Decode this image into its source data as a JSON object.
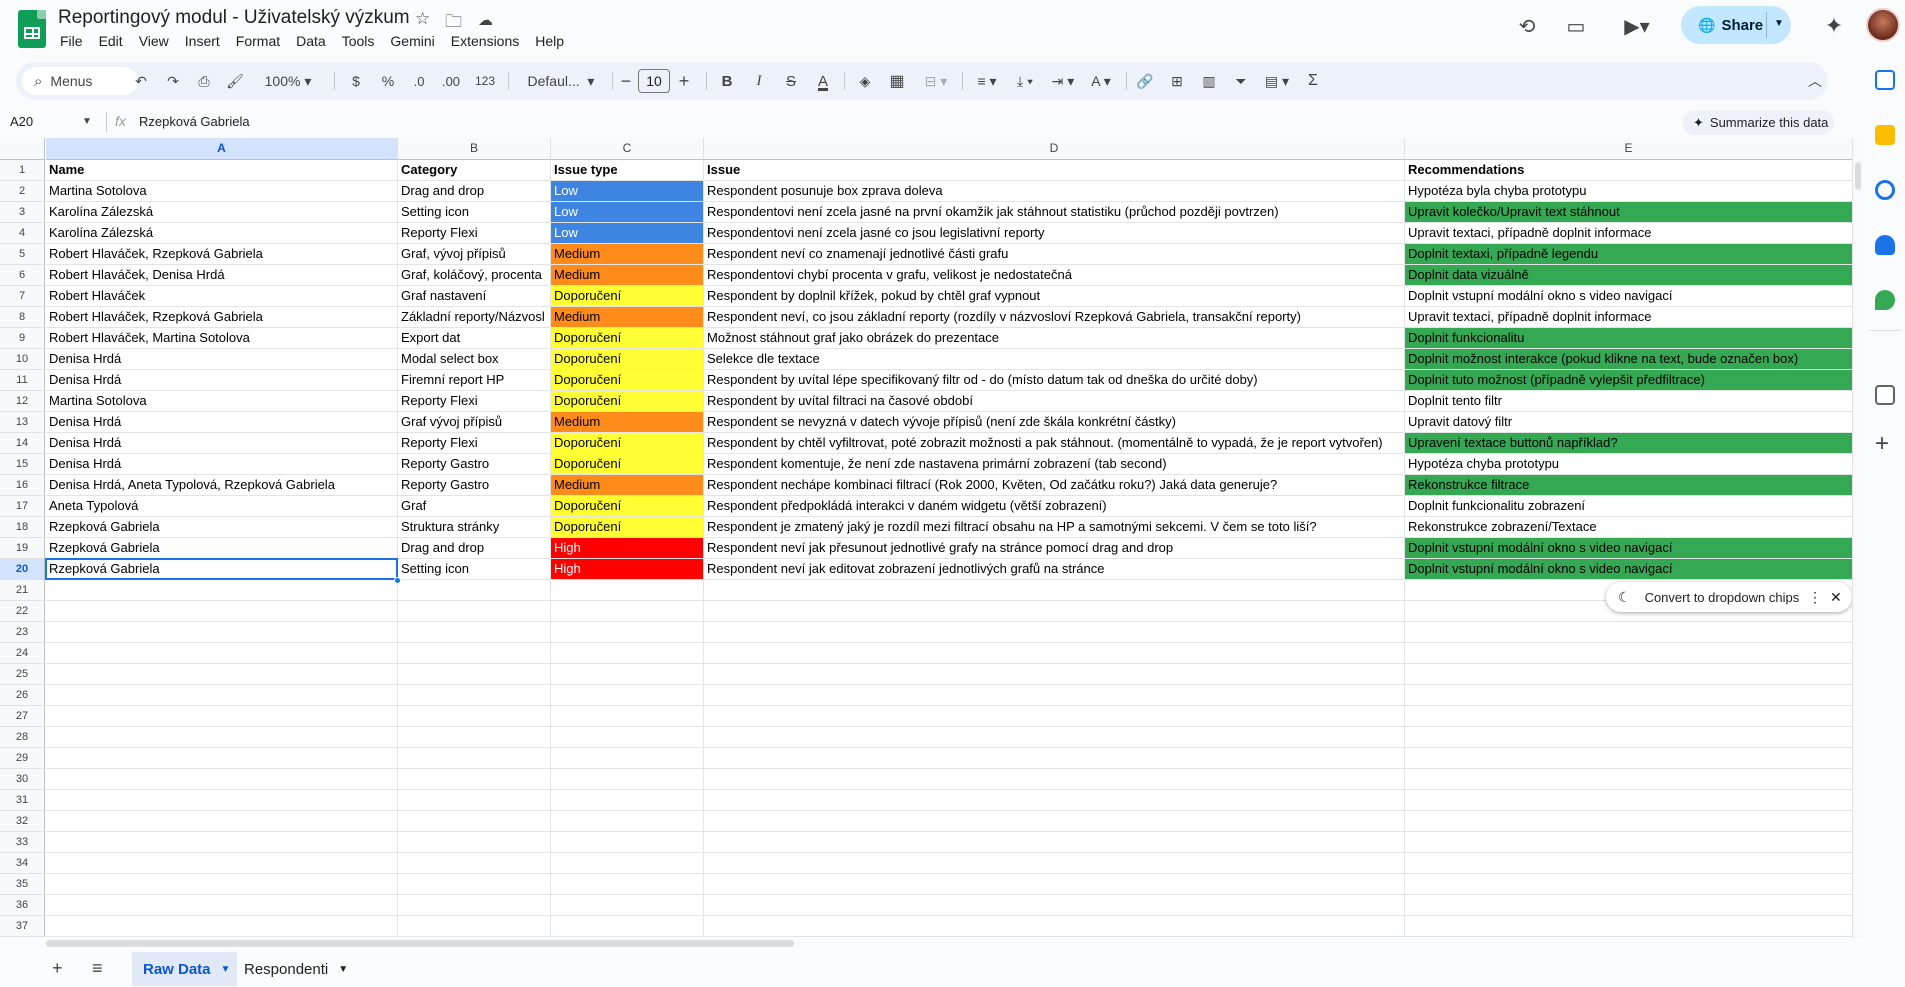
{
  "title": "Reportingový modul - Uživatelský výzkum",
  "menu": [
    "File",
    "Edit",
    "View",
    "Insert",
    "Format",
    "Data",
    "Tools",
    "Gemini",
    "Extensions",
    "Help"
  ],
  "share_label": "Share",
  "toolbar": {
    "search": "Menus",
    "zoom": "100%",
    "currency": "$",
    "percent": "%",
    "dec_decrease": ".0",
    "dec_increase": ".00",
    "number_format": "123",
    "font": "Defaul...",
    "font_size": "10"
  },
  "formula_bar": {
    "cell_ref": "A20",
    "fx": "fx",
    "value": "Rzepková Gabriela",
    "summarize": "Summarize this data"
  },
  "columns": [
    "A",
    "B",
    "C",
    "D",
    "E"
  ],
  "rows": [
    [
      "Name",
      "Category",
      "Issue type",
      "Issue",
      "Recommendations"
    ],
    [
      "Martina Sotolova",
      "Drag and drop",
      "Low",
      "Respondent posunuje box zprava doleva",
      "Hypotéza byla chyba prototypu"
    ],
    [
      "Karolína Zálezská",
      "Setting icon",
      "Low",
      "Respondentovi není zcela jasné na první okamžik jak stáhnout statistiku (průchod později povtrzen)",
      "Upravit kolečko/Upravit text stáhnout"
    ],
    [
      "Karolína Zálezská",
      "Reporty Flexi",
      "Low",
      "Respondentovi není zcela jasné co jsou legislativní reporty",
      "Upravit textaci, případně doplnit informace"
    ],
    [
      "Robert Hlaváček, Rzepková Gabriela",
      "Graf, vývoj přípisů",
      "Medium",
      "Respondent neví co znamenají jednotlivé části grafu",
      "Doplnit textaxi, případně legendu"
    ],
    [
      "Robert Hlaváček, Denisa Hrdá",
      "Graf, koláčový, procenta",
      "Medium",
      "Respondentovi chybí procenta v grafu, velikost je nedostatečná",
      "Doplnit data vizuálně"
    ],
    [
      "Robert Hlaváček",
      "Graf nastavení",
      "Doporučení",
      "Respondent by doplnil křížek, pokud by chtěl graf vypnout",
      "Doplnit vstupní modální okno s video navigací"
    ],
    [
      "Robert Hlaváček, Rzepková Gabriela",
      "Základní reporty/Názvosl",
      "Medium",
      "Respondent neví, co jsou základní reporty (rozdíly v názvosloví Rzepková Gabriela, transakční reporty)",
      "Upravit textaci, případně doplnit informace"
    ],
    [
      "Robert Hlaváček, Martina Sotolova",
      "Export dat",
      "Doporučení",
      "Možnost stáhnout graf jako obrázek do prezentace",
      "Doplnit funkcionalitu"
    ],
    [
      "Denisa Hrdá",
      "Modal select box",
      "Doporučení",
      "Selekce dle textace",
      "Doplnit možnost interakce (pokud klikne na text, bude označen box)"
    ],
    [
      "Denisa Hrdá",
      "Firemní report HP",
      "Doporučení",
      "Respondent by uvítal lépe specifikovaný filtr od - do (místo datum tak od dneška do určité doby)",
      "Doplnit tuto možnost (případně vylepšit předfiltrace)"
    ],
    [
      "Martina Sotolova",
      "Reporty Flexi",
      "Doporučení",
      "Respondent by uvítal filtraci na časové období",
      "Doplnit tento filtr"
    ],
    [
      "Denisa Hrdá",
      "Graf vývoj přípisů",
      "Medium",
      "Respondent se nevyzná v datech vývoje přípisů (není zde škála konkrétní částky)",
      "Upravit datový filtr"
    ],
    [
      "Denisa Hrdá",
      "Reporty Flexi",
      "Doporučení",
      "Respondent by chtěl vyfiltrovat, poté zobrazit možnosti a pak stáhnout. (momentálně to vypadá, že je report vytvořen)",
      "Upravení textace buttonů například?"
    ],
    [
      "Denisa Hrdá",
      "Reporty Gastro",
      "Doporučení",
      "Respondent komentuje, že není zde nastavena primární zobrazení (tab second)",
      "Hypotéza chyba prototypu"
    ],
    [
      "Denisa Hrdá, Aneta Typolová, Rzepková Gabriela",
      "Reporty Gastro",
      "Medium",
      "Respondent nechápe kombinaci filtrací (Rok 2000, Květen, Od začátku roku?) Jaká data generuje?",
      "Rekonstrukce filtrace"
    ],
    [
      "Aneta Typolová",
      "Graf",
      "Doporučení",
      "Respondent předpokládá interakci v daném widgetu (větší zobrazení)",
      "Doplnit funkcionalitu zobrazení"
    ],
    [
      "Rzepková Gabriela",
      "Struktura stránky",
      "Doporučení",
      "Respondent je zmatený jaký je rozdíl mezi filtrací obsahu na HP a samotnými sekcemi. V čem se toto liší?",
      "Rekonstrukce zobrazení/Textace"
    ],
    [
      "Rzepková Gabriela",
      "Drag and drop",
      "High",
      "Respondent neví jak přesunout jednotlivé grafy na stránce pomocí drag and drop",
      "Doplnit vstupní modální okno s video navigací"
    ],
    [
      "Rzepková Gabriela",
      "Setting icon",
      "High",
      "Respondent neví jak editovat zobrazení jednotlivých grafů na stránce",
      "Doplnit vstupní modální okno s video navigací"
    ]
  ],
  "green_rows": [
    3,
    5,
    6,
    9,
    10,
    11,
    14,
    16,
    19,
    20
  ],
  "total_rows": 37,
  "selected_row": 20,
  "selected_col": "A",
  "chip_prompt": "Convert to dropdown chips",
  "sheets": [
    "Raw Data",
    "Respondenti"
  ],
  "colors": {
    "low": "#3d85e0",
    "medium": "#ff8c1a",
    "doporuceni": "#ffff33",
    "high": "#ff0000",
    "green": "#34a853",
    "accent": "#0b57d0"
  }
}
